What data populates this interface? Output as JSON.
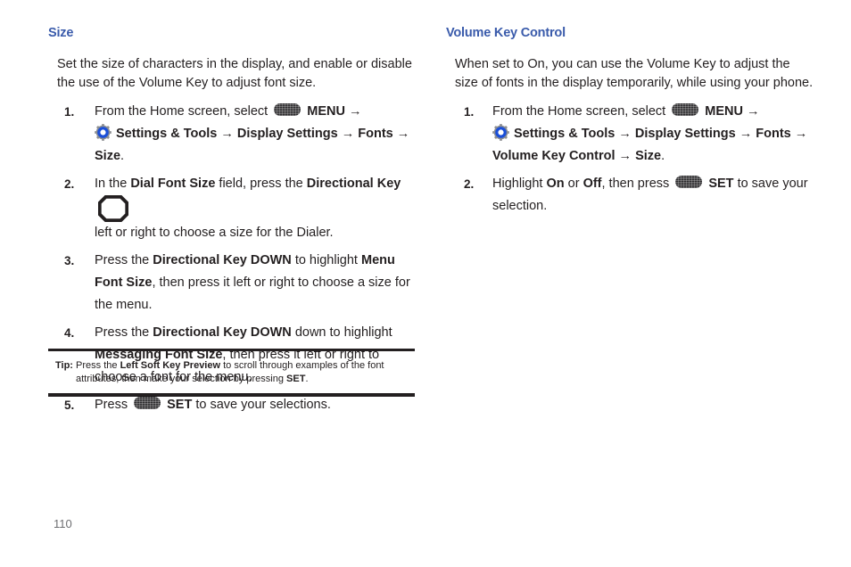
{
  "document": {
    "page_number": "110",
    "heading_color": "#3a5bab",
    "text_color": "#231f20",
    "page_number_color": "#6d6e71"
  },
  "left_column": {
    "heading": "Size",
    "intro": "Set the size of characters in the display, and enable or disable the use of the Volume Key to adjust font size.",
    "steps": [
      {
        "number": "1.",
        "line1_pre": "From the Home screen, select",
        "menu_label": "MENU",
        "arrow": "→",
        "path": {
          "item1": "Settings & Tools",
          "arrow1": "→",
          "item2": "Display Settings",
          "arrow2": "→",
          "item3": "Fonts",
          "arrow3": "→",
          "item4": "Size",
          "period": "."
        }
      },
      {
        "number": "2.",
        "pre": "In the",
        "bold1": "Dial Font Size",
        "mid": "field, press the",
        "bold2": "Directional Key",
        "post": "left or right to choose a size for the Dialer."
      },
      {
        "number": "3.",
        "pre": "Press the",
        "bold1": "Directional Key DOWN",
        "mid": "to highlight",
        "bold2": "Menu Font Size",
        "post": ", then press it left or right to choose a size for the menu."
      },
      {
        "number": "4.",
        "pre": "Press the",
        "bold1": "Directional Key DOWN",
        "mid": "down to highlight",
        "bold2": "Messaging Font Size",
        "post": ", then press it left or right to choose a font for the menu."
      },
      {
        "number": "5.",
        "pre": "Press",
        "set_label": "SET",
        "post": "to save your selections."
      }
    ],
    "tip": {
      "label": "Tip:",
      "text_pre": "Press the",
      "bold1": "Left Soft Key Preview",
      "text_mid": "to scroll through examples of the font attributes, then make your selection by pressing",
      "bold2": "SET",
      "text_end": "."
    }
  },
  "right_column": {
    "heading": "Volume Key Control",
    "intro": "When set to On, you can use the Volume Key to adjust the size of fonts in the display temporarily, while using your phone.",
    "steps": [
      {
        "number": "1.",
        "line1_pre": "From the Home screen, select",
        "menu_label": "MENU",
        "arrow": "→",
        "path": {
          "item1": "Settings & Tools",
          "arrow1": "→",
          "item2": "Display Settings",
          "arrow2": "→",
          "item3": "Fonts",
          "arrow3": "→",
          "item4": "Volume Key Control",
          "arrow4": "→",
          "item5": "Size",
          "period": "."
        }
      },
      {
        "number": "2.",
        "pre": "Highlight",
        "bold1": "On",
        "mid": "or",
        "bold2": "Off",
        "mid2": ", then press",
        "set_label": "SET",
        "post": "to save your selection."
      }
    ]
  },
  "icons": {
    "gear": "settings-gear-icon",
    "menu_key": "menu-key-icon",
    "set_key": "set-key-icon",
    "directional_key": "directional-key-icon",
    "arrow": "right-arrow-icon"
  }
}
